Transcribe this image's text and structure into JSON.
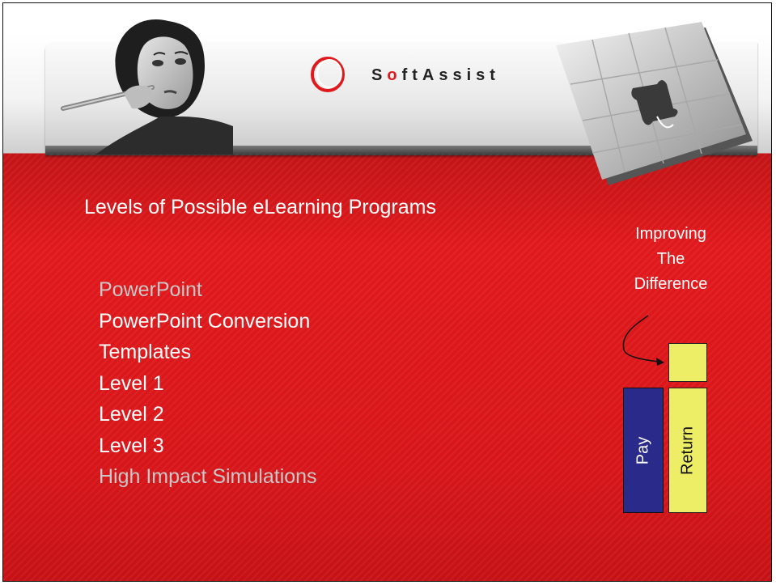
{
  "brand": {
    "logo_text_pre": "S",
    "logo_text_o": "o",
    "logo_text_post": "ftAssist"
  },
  "slide": {
    "heading": "Levels of Possible eLearning Programs",
    "levels": [
      {
        "label": "PowerPoint",
        "dim": true
      },
      {
        "label": "PowerPoint Conversion",
        "dim": false
      },
      {
        "label": "Templates",
        "dim": false
      },
      {
        "label": "Level 1",
        "dim": false
      },
      {
        "label": "Level 2",
        "dim": false
      },
      {
        "label": "Level 3",
        "dim": false
      },
      {
        "label": "High Impact Simulations",
        "dim": true
      }
    ],
    "improving": {
      "line1": "Improving",
      "line2": "The",
      "line3": "Difference"
    },
    "bars": {
      "pay_label": "Pay",
      "return_label": "Return"
    }
  },
  "colors": {
    "accent_red": "#e0191c",
    "pay_blue": "#2a2a8a",
    "return_yellow": "#eeee66",
    "dim_text": "#c8c8c8"
  }
}
